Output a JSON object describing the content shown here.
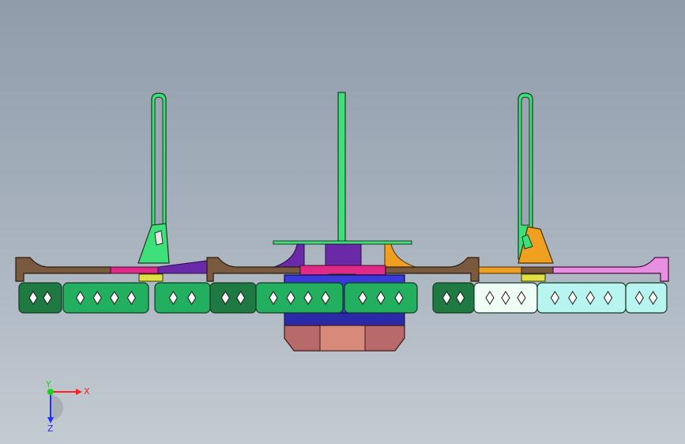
{
  "view": {
    "background_top": "#8f9caa",
    "background_bottom": "#c4cbd2"
  },
  "triad": {
    "x_label": "X",
    "y_label": "Y",
    "z_label": "Z",
    "x_color": "#ff2020",
    "y_color": "#20d020",
    "z_color": "#2030ff"
  },
  "model": {
    "icons": [
      "drone-frame-assembly"
    ],
    "part_colors": {
      "frame": "#7a5a3e",
      "post": "#3ee07a",
      "motor_green": "#22b060",
      "motor_dark": "#1e7a42",
      "motor_cyan": "#b8f5f0",
      "motor_pale": "#f0fff8",
      "hub_blue": "#3a3ad8",
      "hub_purple": "#6a2aa8",
      "bottom_pink": "#b86a6a",
      "accent_magenta": "#e02a8a",
      "accent_orange": "#f0a020",
      "accent_pink": "#e890e0",
      "accent_yellow": "#e0e040"
    }
  }
}
